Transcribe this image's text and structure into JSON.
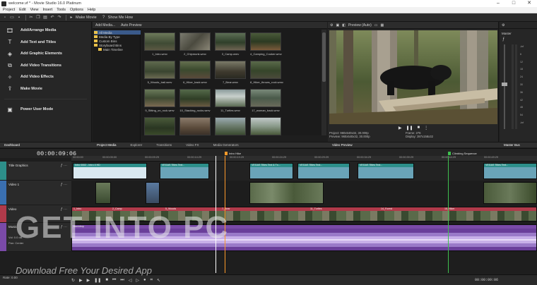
{
  "window": {
    "title": "welcome.vf * - Movie Studio 16.0 Platinum",
    "controls": [
      "–",
      "□",
      "✕"
    ]
  },
  "menu": [
    "Project",
    "Edit",
    "View",
    "Insert",
    "Tools",
    "Options",
    "Help"
  ],
  "toolbar": {
    "make_movie": "Make Movie",
    "show_me_how": "Show Me How"
  },
  "wizard": [
    {
      "label": "Add/Arrange Media",
      "icon": "film-icon"
    },
    {
      "label": "Add Text and Titles",
      "icon": "text-icon"
    },
    {
      "label": "Add Graphic Elements",
      "icon": "graphic-icon"
    },
    {
      "label": "Add Video Transitions",
      "icon": "transition-icon"
    },
    {
      "label": "Add Video Effects",
      "icon": "effects-icon"
    },
    {
      "label": "Make Movie",
      "icon": "share-icon"
    },
    {
      "label": "Power User Mode",
      "icon": "power-icon"
    }
  ],
  "left_tabs": [
    "Dashboard"
  ],
  "media": {
    "add_media": "Add Media...",
    "auto_preview": "Auto Preview",
    "tree": [
      "All Media",
      "Media By Type",
      "Custom Bins",
      "Storyboard Bins",
      "Main Timeline"
    ],
    "thumbs": [
      "1_Intro.wmv",
      "2_Chipmunk.wmv",
      "3_Camp.wmv",
      "4_Camping_Cooker.wmv",
      "5_Woods_trail.wmv",
      "6_Hiker_back.wmv",
      "7_Bear.wmv",
      "8_Hiker_throws_rock.wmv",
      "9_Sitting_on_rock.wmv",
      "10_Stacking_rocks.wmv",
      "11_Turtles.wmv",
      "17_woman_back.wmv",
      "",
      "",
      "",
      ""
    ]
  },
  "middle_tabs": [
    "Project Media",
    "Explorer",
    "Transitions",
    "Video FX",
    "Media Generators"
  ],
  "preview": {
    "mode": "Preview (Auto)",
    "project_label": "Project:",
    "project_value": "960x540x32, 30.000p",
    "preview_label": "Preview:",
    "preview_value": "960x540x32, 30.000p",
    "frame_label": "Frame:",
    "frame_value": "276",
    "display_label": "Display:",
    "display_value": "397x158x32",
    "tab": "Video Preview"
  },
  "master": {
    "title": "Master",
    "tab": "Master Bus",
    "scale": [
      "-Inf",
      "6",
      "12",
      "18",
      "24",
      "30",
      "36",
      "42",
      "48",
      "54",
      "-Inf"
    ]
  },
  "timeline": {
    "timecode": "00:00:09:06",
    "ruler": [
      "00:00:00",
      "00:00:05:00",
      "00:00:09:29",
      "00:00:14:29",
      "00:00:19:29",
      "00:00:24:29",
      "00:00:29:29",
      "00:00:34:29",
      "00:00:39:29",
      "00:00:44:29",
      "00:00:49:29"
    ],
    "marker_intro": "Intro Hike",
    "marker_climbing": "Climbing Sequence",
    "tracks": [
      {
        "name": "Title Graphics",
        "color": "#2d8f8a"
      },
      {
        "name": "Video 1",
        "color": "#3a6fb0"
      },
      {
        "name": "",
        "color": "#444"
      },
      {
        "name": "Video",
        "color": "#b03a4a"
      },
      {
        "name": "Music",
        "color": "#7a4aa8"
      }
    ],
    "title_clips": [
      "Intro 0002 - Intro 4 HD",
      "VEGAS Titles Text...",
      "VEGAS Titles Text & Tx...",
      "VEGAS Titles Text...",
      "VEGAS Titles Text..."
    ],
    "video_clips": [
      "",
      "",
      "1_Intro",
      "2_Camp",
      "",
      "5_Woods",
      "",
      "",
      "7_Bear",
      "",
      "",
      "11_Turtles",
      "",
      "",
      "14_Forest",
      "15_Hiker"
    ],
    "music_label": "Backdrop",
    "music_vol": "Vol:",
    "music_vol_value": "0.0 dB",
    "music_pan": "Pan:",
    "music_pan_value": "Center"
  },
  "status": {
    "rate": "Rate: 0.00",
    "bottom_timecode": "00:00:09:06"
  },
  "watermark": {
    "main": "GET INTO PC",
    "sub": "Download Free Your Desired App"
  }
}
